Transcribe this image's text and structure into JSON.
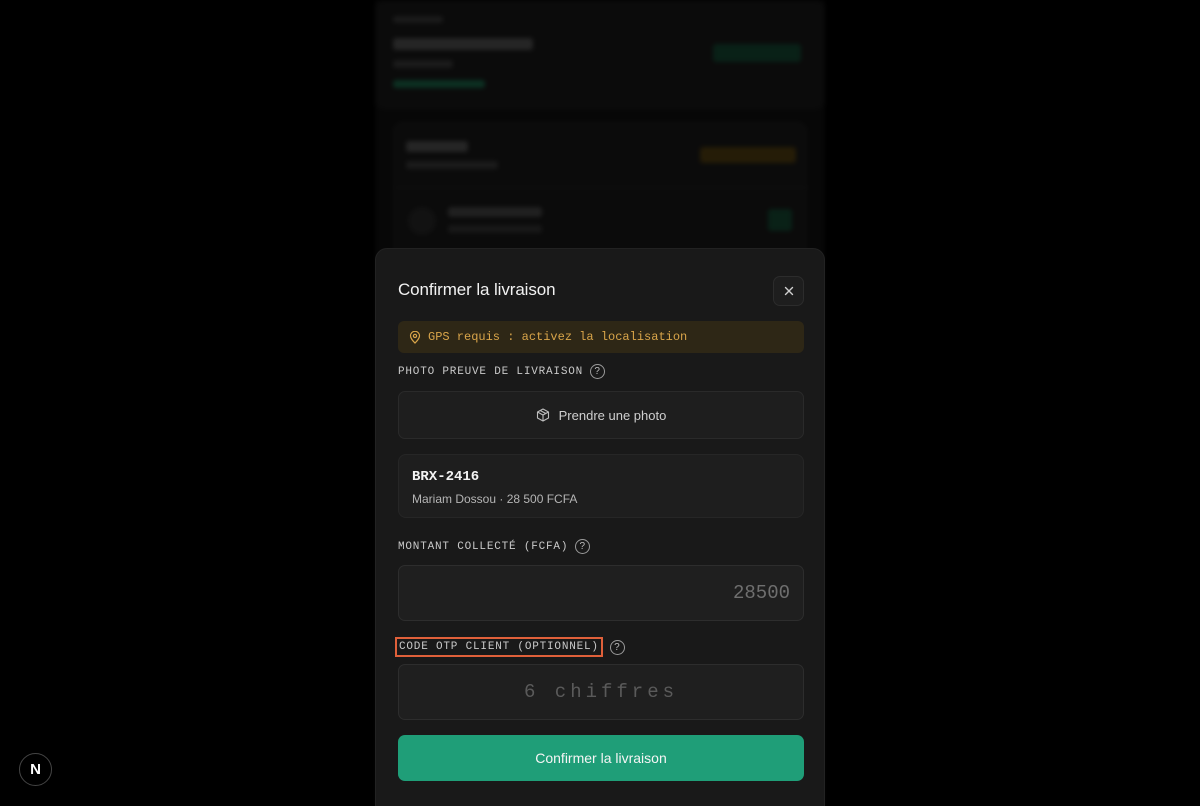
{
  "background": {
    "section_label": "COMMANDE",
    "merchant_name": "Epices d'Abomey",
    "merchant_address": "Cotonou",
    "merchant_status": "Pickup",
    "merchant_badge": "Récupéré",
    "order_ref": "BRX-2416",
    "order_meta": "2,4 km · 12 min",
    "order_badge": "EN LIVRAISON",
    "customer_name": "Mariam Dossou",
    "customer_address": "Akpakpa, Cotonou"
  },
  "modal": {
    "title": "Confirmer la livraison",
    "close_icon": "x-icon",
    "gps_warning": "GPS requis : activez la localisation",
    "photo_label": "PHOTO PREUVE DE LIVRAISON",
    "photo_button": "Prendre une photo",
    "order": {
      "id": "BRX-2416",
      "summary": "Mariam Dossou · 28 500  FCFA"
    },
    "amount_label": "MONTANT COLLECTÉ (FCFA)",
    "amount_placeholder": "28500",
    "otp_label": "CODE OTP CLIENT (OPTIONNEL)",
    "otp_placeholder": "6 chiffres",
    "confirm_button": "Confirmer la livraison"
  },
  "devtools": {
    "badge": "N"
  },
  "colors": {
    "accent": "#1f9e78",
    "warning_text": "#d9a54a",
    "warning_bg": "#2e2716",
    "highlight": "#e0603a"
  }
}
